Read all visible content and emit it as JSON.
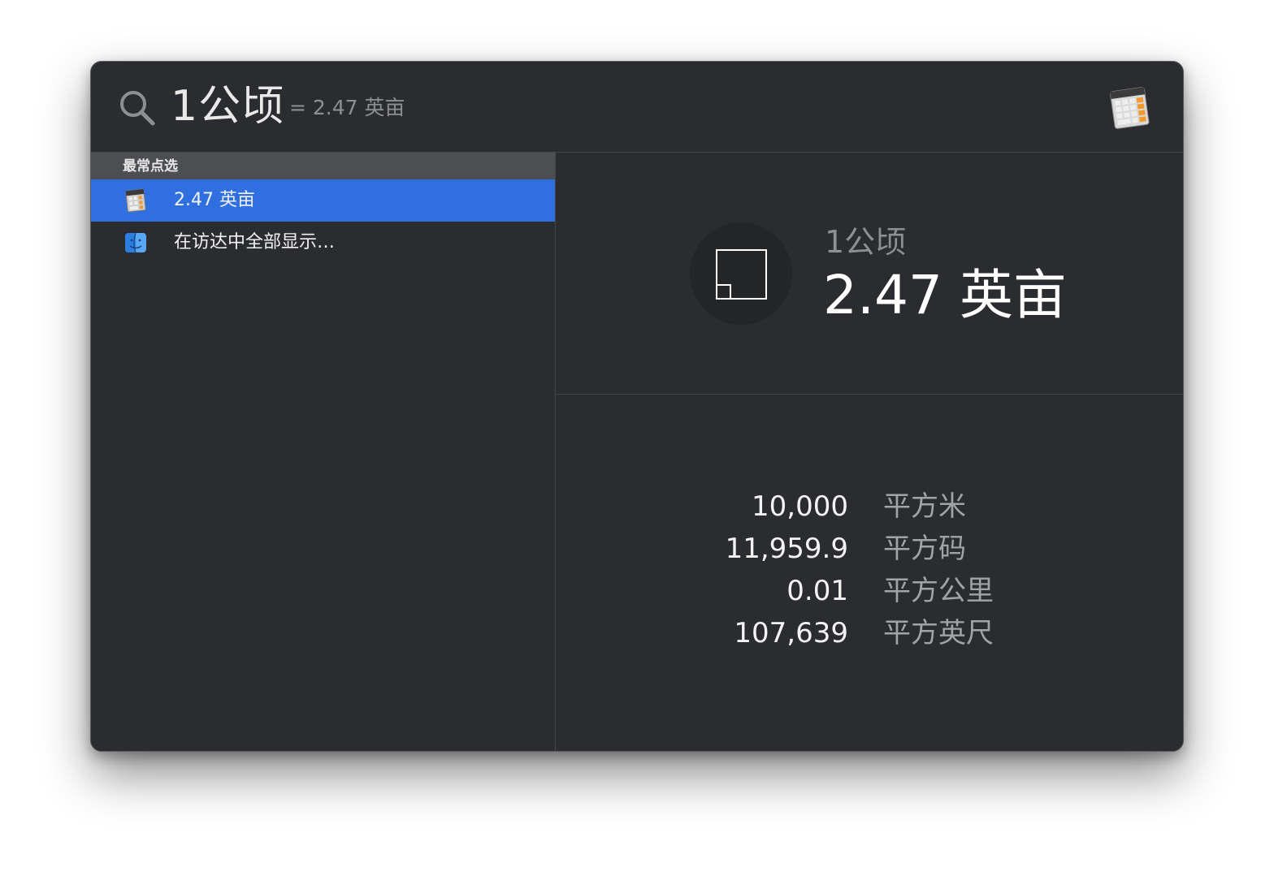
{
  "search": {
    "query": "1公顷",
    "completion": "= 2.47 英亩"
  },
  "results": {
    "section_title": "最常点选",
    "items": [
      {
        "label": "2.47 英亩",
        "icon": "calculator-icon",
        "selected": true
      },
      {
        "label": "在访达中全部显示…",
        "icon": "finder-icon",
        "selected": false
      }
    ]
  },
  "preview": {
    "icon": "area-icon",
    "input": "1公顷",
    "result": "2.47 英亩",
    "conversions": [
      {
        "value": "10,000",
        "unit": "平方米"
      },
      {
        "value": "11,959.9",
        "unit": "平方码"
      },
      {
        "value": "0.01",
        "unit": "平方公里"
      },
      {
        "value": "107,639",
        "unit": "平方英尺"
      }
    ]
  },
  "colors": {
    "window_bg": "#2b2c2f",
    "selection": "#2f6fe0",
    "section_header_bg": "#4d4e52"
  }
}
